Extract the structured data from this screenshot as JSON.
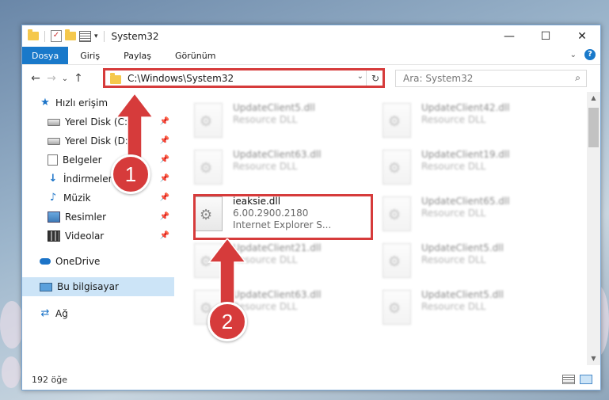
{
  "window": {
    "title": "System32",
    "controls": {
      "minimize": "—",
      "maximize": "☐",
      "close": "✕"
    }
  },
  "quick_access_toolbar": {
    "dropdown": "▾"
  },
  "ribbon": {
    "tabs": [
      "Dosya",
      "Giriş",
      "Paylaş",
      "Görünüm"
    ],
    "collapse_glyph": "⌄",
    "help_glyph": "?"
  },
  "navigation": {
    "back": "←",
    "forward": "→",
    "recent": "⌄",
    "up": "↑",
    "address_path": "C:\\Windows\\System32",
    "address_dropdown": "⌄",
    "refresh": "↻",
    "search_placeholder": "Ara: System32",
    "search_glyph": "⌕"
  },
  "sidebar": {
    "items": [
      {
        "label": "Hızlı erişim",
        "icon": "star-icon",
        "pinned": false
      },
      {
        "label": "Yerel Disk (C:)",
        "icon": "drive-icon",
        "pinned": true
      },
      {
        "label": "Yerel Disk (D:)",
        "icon": "drive-icon",
        "pinned": true
      },
      {
        "label": "Belgeler",
        "icon": "documents-icon",
        "pinned": true
      },
      {
        "label": "İndirmeler",
        "icon": "downloads-icon",
        "pinned": true
      },
      {
        "label": "Müzik",
        "icon": "music-icon",
        "pinned": true
      },
      {
        "label": "Resimler",
        "icon": "pictures-icon",
        "pinned": true
      },
      {
        "label": "Videolar",
        "icon": "videos-icon",
        "pinned": true
      },
      {
        "label": "OneDrive",
        "icon": "cloud-icon",
        "pinned": false
      },
      {
        "label": "Bu bilgisayar",
        "icon": "computer-icon",
        "pinned": false,
        "selected": true
      },
      {
        "label": "Ağ",
        "icon": "network-icon",
        "pinned": false
      }
    ],
    "pin_glyph": "📌"
  },
  "files": [
    {
      "name": "UpdateClient5.dll",
      "line2": "Resource DLL",
      "line3": "",
      "blurred": true
    },
    {
      "name": "UpdateClient42.dll",
      "line2": "Resource DLL",
      "line3": "",
      "blurred": true
    },
    {
      "name": "UpdateClient63.dll",
      "line2": "Resource DLL",
      "line3": "",
      "blurred": true
    },
    {
      "name": "UpdateClient19.dll",
      "line2": "Resource DLL",
      "line3": "",
      "blurred": true
    },
    {
      "name": "ieaksie.dll",
      "line2": "6.00.2900.2180",
      "line3": "Internet Explorer S...",
      "blurred": false
    },
    {
      "name": "UpdateClient65.dll",
      "line2": "Resource DLL",
      "line3": "",
      "blurred": true
    },
    {
      "name": "UpdateClient21.dll",
      "line2": "Resource DLL",
      "line3": "",
      "blurred": true
    },
    {
      "name": "UpdateClient5.dll",
      "line2": "Resource DLL",
      "line3": "",
      "blurred": true
    },
    {
      "name": "UpdateClient63.dll",
      "line2": "Resource DLL",
      "line3": "",
      "blurred": true
    },
    {
      "name": "UpdateClient5.dll",
      "line2": "Resource DLL",
      "line3": "",
      "blurred": true
    }
  ],
  "status_bar": {
    "item_count": "192 öğe"
  },
  "annotations": {
    "step1": "1",
    "step2": "2",
    "color": "#d63b3b"
  }
}
